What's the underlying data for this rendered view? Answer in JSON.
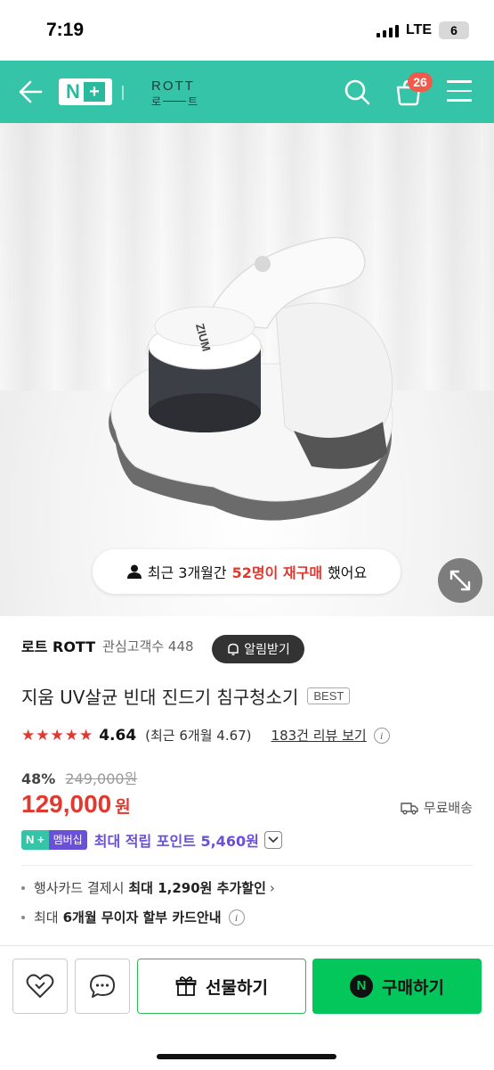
{
  "status_bar": {
    "time": "7:19",
    "network": "LTE",
    "battery": "6"
  },
  "nav": {
    "logo_n": "N",
    "logo_plus": "+",
    "brand_top": "ROTT",
    "brand_bottom_left": "로",
    "brand_bottom_right": "트",
    "cart_count": "26",
    "accent_color": "#35c4a8"
  },
  "hero": {
    "product_label": "ZIUM",
    "repurchase": {
      "prefix": "최근 3개월간",
      "highlight": "52명이 재구매",
      "suffix": "했어요"
    }
  },
  "product": {
    "brand": "로트 ROTT",
    "fans_label": "관심고객수 448",
    "alert_label": "알림받기",
    "title": "지움 UV살균 빈대 진드기 침구청소기",
    "badge": "BEST",
    "stars": "★★★★★",
    "rating": "4.64",
    "rating_recent": "(최근 6개월 4.67)",
    "review_link": "183건 리뷰 보기",
    "discount": "48%",
    "original_price": "249,000원",
    "price": "129,000",
    "currency": "원",
    "shipping": "무료배송",
    "member_logo": "N +",
    "member_badge": "멤버십",
    "member_text": "최대 적립 포인트 5,460원",
    "price_color": "#e0392f",
    "member_color": "#6a4fd8"
  },
  "benefits": [
    {
      "label": "행사카드 결제시",
      "bold": "최대 1,290원 추가할인",
      "suffix": "›"
    },
    {
      "label": "최대",
      "bold": "6개월 무이자 할부 카드안내",
      "suffix": ""
    }
  ],
  "bottom": {
    "gift_label": "선물하기",
    "buy_label": "구매하기",
    "buy_logo": "N",
    "buy_color": "#03c75a"
  }
}
